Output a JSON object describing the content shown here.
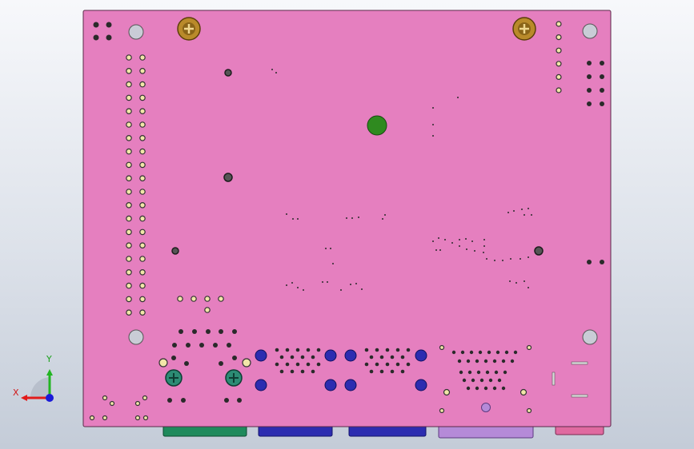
{
  "viewport": {
    "background": "#dde2ea",
    "axis_labels": {
      "x": "X",
      "y": "Y"
    }
  },
  "board": {
    "color": "#e57fbf",
    "edge_color": "#5a2a48",
    "hole_color": "#c9ccd6",
    "via_color": "#2a2a2a",
    "pad_color": "#f2e6a8"
  },
  "components": {
    "mounting_screws_color": "#b98a2a",
    "green_pad_color": "#2f8a1f",
    "connector_teal": "#1f8a5c",
    "connector_blue": "#2c2cb0",
    "connector_purple": "#b58ad8",
    "connector_pink": "#e06aa0",
    "capacitor_teal": "#2c8b74"
  },
  "triad_colors": {
    "x": "#e21b1b",
    "y": "#22b522",
    "z": "#1a1ad8"
  }
}
